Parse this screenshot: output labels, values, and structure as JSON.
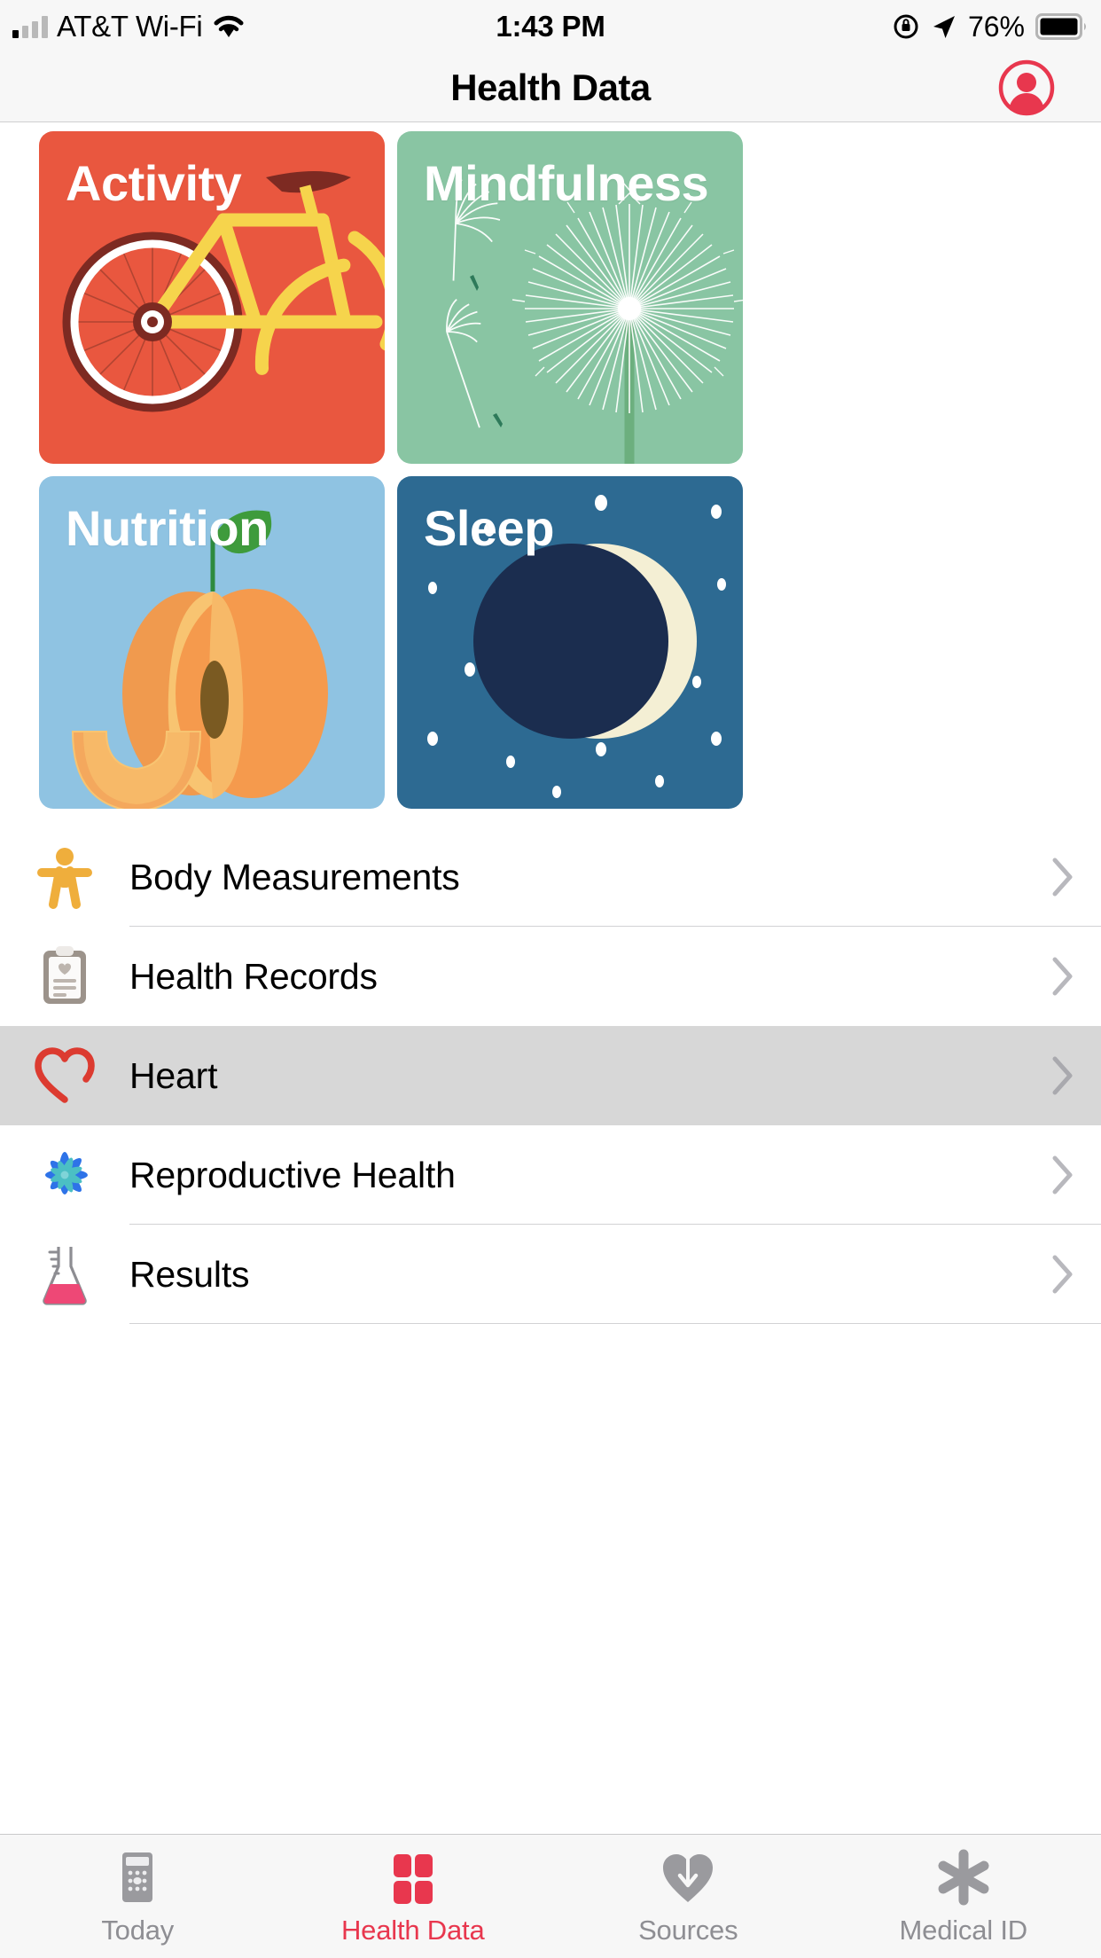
{
  "status_bar": {
    "carrier": "AT&T Wi-Fi",
    "wifi_icon": "wifi-icon",
    "signal_icon": "cellular-signal-icon",
    "time": "1:43 PM",
    "rotation_lock_icon": "rotation-lock-icon",
    "location_icon": "location-arrow-icon",
    "battery_percent": "76%",
    "battery_icon": "battery-icon"
  },
  "navbar": {
    "title": "Health Data",
    "avatar_icon": "profile-avatar-icon",
    "avatar_color": "#E8374E"
  },
  "tiles": [
    {
      "label": "Activity",
      "name": "tile-activity",
      "color": "#E9573F",
      "art": "bicycle-illustration"
    },
    {
      "label": "Mindfulness",
      "name": "tile-mindfulness",
      "color": "#89C5A3",
      "art": "dandelion-illustration"
    },
    {
      "label": "Nutrition",
      "name": "tile-nutrition",
      "color": "#8FC3E2",
      "art": "peach-illustration"
    },
    {
      "label": "Sleep",
      "name": "tile-sleep",
      "color": "#2D6A92",
      "art": "crescent-moon-illustration"
    }
  ],
  "list": [
    {
      "label": "Body Measurements",
      "icon": "body-person-icon",
      "selected": false
    },
    {
      "label": "Health Records",
      "icon": "clipboard-icon",
      "selected": false
    },
    {
      "label": "Heart",
      "icon": "heart-outline-icon",
      "selected": true
    },
    {
      "label": "Reproductive Health",
      "icon": "flower-icon",
      "selected": false
    },
    {
      "label": "Results",
      "icon": "lab-flask-icon",
      "selected": false
    }
  ],
  "tabbar": {
    "active_color": "#E8374E",
    "inactive_color": "#8E8E93",
    "items": [
      {
        "label": "Today",
        "icon": "today-calendar-icon",
        "active": false
      },
      {
        "label": "Health Data",
        "icon": "health-grid-icon",
        "active": true
      },
      {
        "label": "Sources",
        "icon": "sources-heart-icon",
        "active": false
      },
      {
        "label": "Medical ID",
        "icon": "medical-id-icon",
        "active": false
      }
    ]
  }
}
